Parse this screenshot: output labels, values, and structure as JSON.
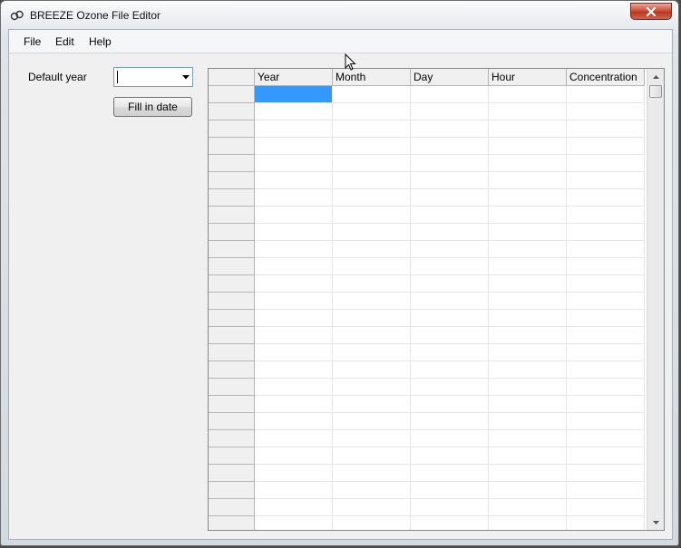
{
  "window": {
    "title": "BREEZE Ozone File Editor"
  },
  "menubar": {
    "items": [
      "File",
      "Edit",
      "Help"
    ]
  },
  "form": {
    "default_year_label": "Default year",
    "default_year_value": "",
    "fill_button_label": "Fill in date"
  },
  "grid": {
    "columns": [
      "Year",
      "Month",
      "Day",
      "Hour",
      "Concentration"
    ],
    "visible_rows": 26,
    "selected_cell": {
      "row": 0,
      "column": "Year"
    }
  },
  "colors": {
    "selection": "#3399ff",
    "close_button": "#c9533f",
    "header_bg": "#f0f0f0"
  },
  "icons": {
    "app": "breeze-app-icon",
    "close": "close-icon",
    "dropdown": "chevron-down-icon",
    "scroll_up": "scroll-up-icon",
    "scroll_down": "scroll-down-icon"
  }
}
